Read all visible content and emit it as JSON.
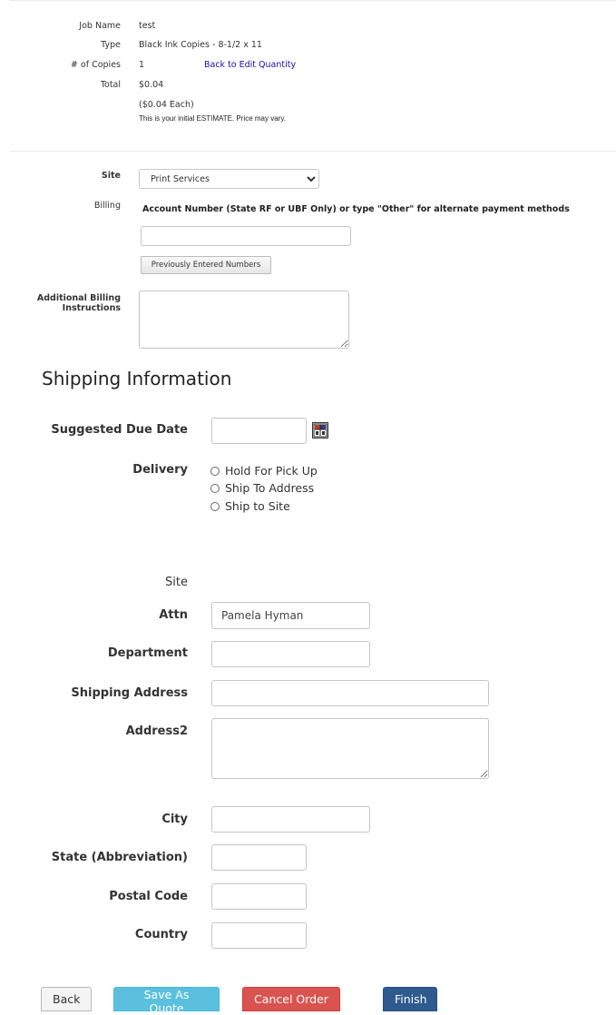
{
  "summary": {
    "job_name_label": "Job Name",
    "job_name_value": "test",
    "type_label": "Type",
    "type_value": "Black Ink Copies - 8-1/2 x 11",
    "copies_label": "# of Copies",
    "copies_value": "1",
    "edit_quantity_link": "Back to Edit Quantity",
    "total_label": "Total",
    "total_value": "$0.04",
    "each_value": "($0.04 Each)",
    "estimate_note": "This is your initial ESTIMATE. Price may vary."
  },
  "billing": {
    "site_label": "Site",
    "site_selected": "Print Services",
    "billing_label": "Billing",
    "account_heading": "Account Number (State RF or UBF Only) or type \"Other\" for alternate payment methods",
    "account_value": "",
    "previous_button": "Previously Entered Numbers",
    "additional_label_line1": "Additional Billing",
    "additional_label_line2": "Instructions",
    "additional_value": ""
  },
  "shipping": {
    "title": "Shipping Information",
    "due_date_label": "Suggested Due Date",
    "due_date_value": "",
    "calendar_icon": "calendar-icon",
    "delivery_label": "Delivery",
    "delivery_options": [
      "Hold For Pick Up",
      "Ship To Address",
      "Ship to Site"
    ],
    "site_label": "Site",
    "attn_label": "Attn",
    "attn_value": "Pamela Hyman",
    "department_label": "Department",
    "department_value": "",
    "address_label": "Shipping Address",
    "address_value": "",
    "address2_label": "Address2",
    "address2_value": "",
    "city_label": "City",
    "city_value": "",
    "state_label": "State (Abbreviation)",
    "state_value": "",
    "postal_label": "Postal Code",
    "postal_value": "",
    "country_label": "Country",
    "country_value": ""
  },
  "actions": {
    "back": "Back",
    "save_quote": "Save As Quote",
    "cancel": "Cancel Order",
    "finish": "Finish"
  },
  "colors": {
    "link": "#1a0dab",
    "info_button": "#5bc0de",
    "danger_button": "#d9534f",
    "primary_button": "#2e5a8f"
  }
}
